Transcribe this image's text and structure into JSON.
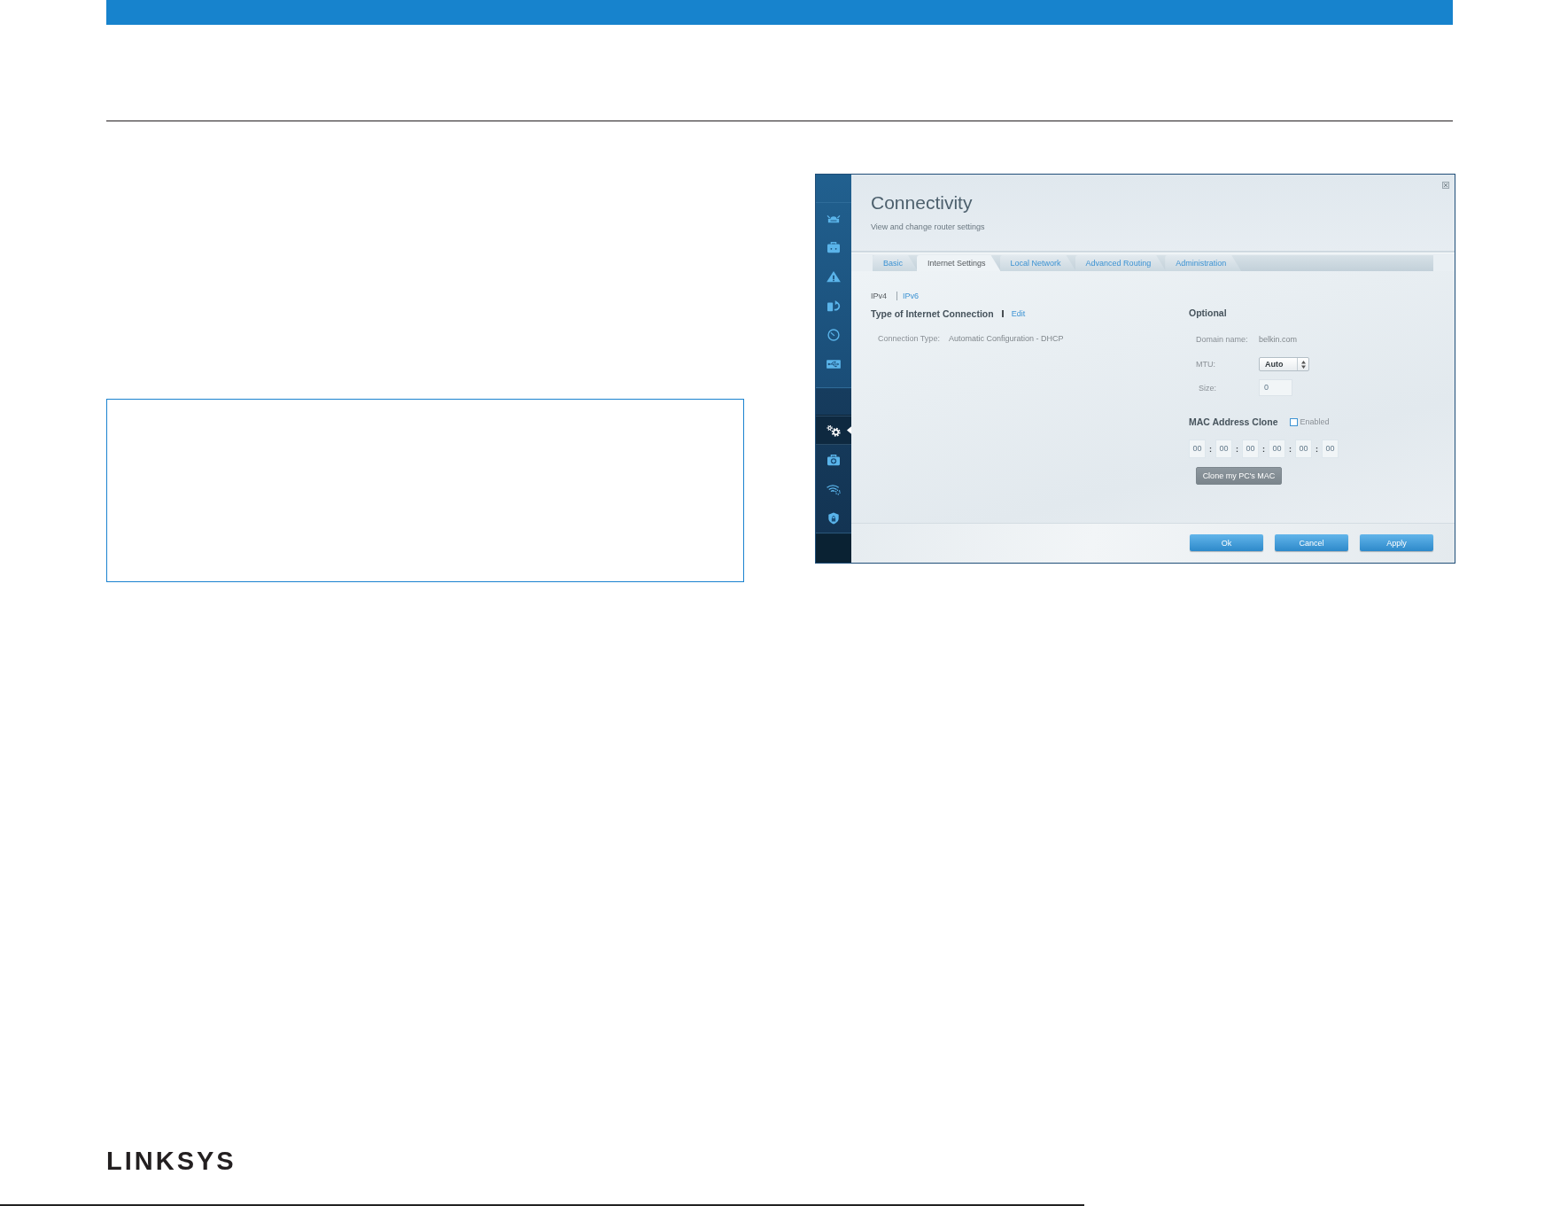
{
  "screenshot": {
    "title": "Connectivity",
    "subtitle": "View and change router settings",
    "sidebar": {
      "groups": [
        {
          "items": [
            {
              "kind": "router",
              "selected": false
            },
            {
              "kind": "briefcase",
              "selected": false
            },
            {
              "kind": "warning",
              "selected": false
            },
            {
              "kind": "devices",
              "selected": false
            },
            {
              "kind": "gauge",
              "selected": false
            },
            {
              "kind": "usb",
              "selected": false
            }
          ]
        },
        {
          "items": [
            {
              "kind": "gears",
              "selected": true
            },
            {
              "kind": "medkit",
              "selected": false
            },
            {
              "kind": "wifi",
              "selected": false
            },
            {
              "kind": "shield",
              "selected": false
            }
          ]
        }
      ]
    },
    "tabs": [
      {
        "label": "Basic",
        "selected": false
      },
      {
        "label": "Internet Settings",
        "selected": true
      },
      {
        "label": "Local Network",
        "selected": false
      },
      {
        "label": "Advanced Routing",
        "selected": false
      },
      {
        "label": "Administration",
        "selected": false
      }
    ],
    "ip_versions": [
      {
        "label": "IPv4",
        "selected": true
      },
      {
        "label": "IPv6",
        "selected": false
      }
    ],
    "connection": {
      "heading": "Type of Internet Connection",
      "edit_link": "Edit",
      "label": "Connection Type:",
      "value": "Automatic Configuration - DHCP"
    },
    "optional": {
      "heading": "Optional",
      "domain_label": "Domain name:",
      "domain_value": "belkin.com",
      "mtu_label": "MTU:",
      "mtu_value": "Auto",
      "size_label": "Size:",
      "size_value": "0",
      "size_disabled": true
    },
    "mac_clone": {
      "heading": "MAC Address Clone",
      "checkbox_label": "Enabled",
      "checked": false,
      "octets": [
        "00",
        "00",
        "00",
        "00",
        "00",
        "00"
      ],
      "separators": [
        ":",
        ":",
        ":",
        ":",
        ":"
      ],
      "disabled": true,
      "clone_button": "Clone my PC's MAC"
    },
    "buttons": [
      {
        "label": "Ok"
      },
      {
        "label": "Cancel"
      },
      {
        "label": "Apply"
      }
    ]
  },
  "footer": {
    "logo": "LINKSYS"
  }
}
